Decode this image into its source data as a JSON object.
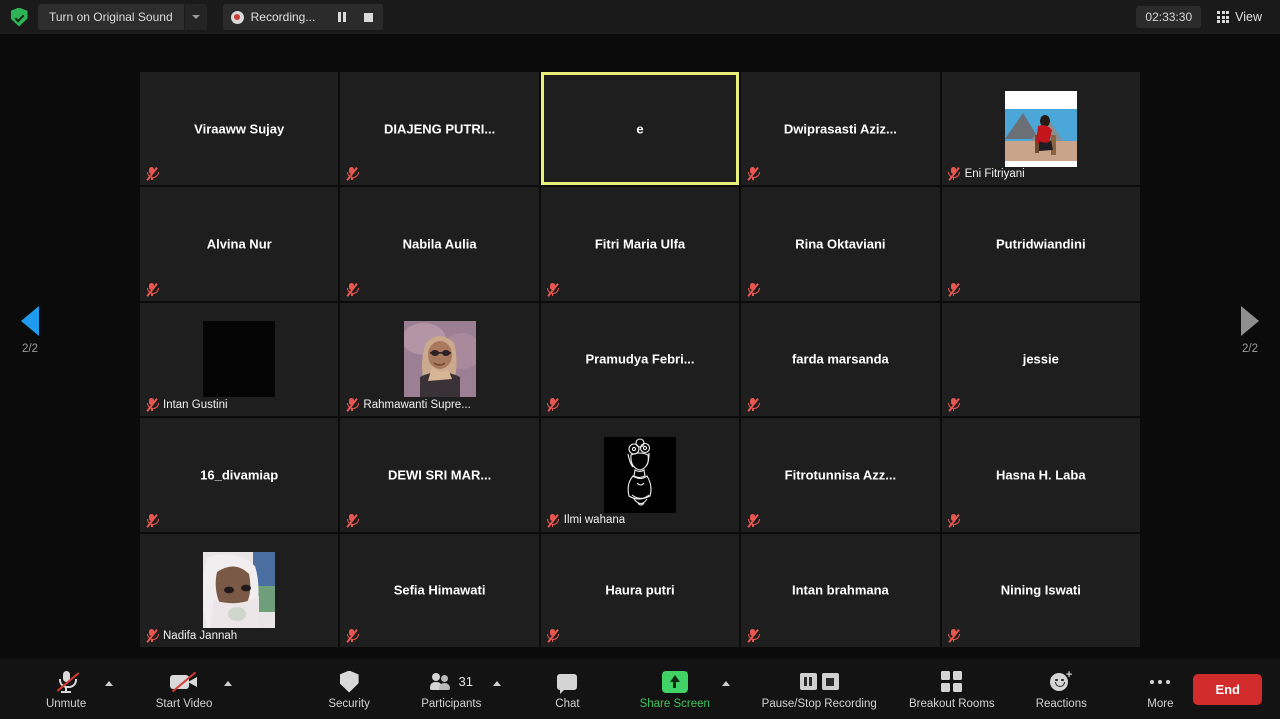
{
  "topbar": {
    "shield_icon": "shield-check-icon",
    "original_sound_label": "Turn on Original Sound",
    "recording_label": "Recording...",
    "pause_icon": "pause-icon",
    "stop_icon": "stop-icon",
    "timer": "02:33:30",
    "view_label": "View",
    "view_icon": "grid-view-icon"
  },
  "gallery": {
    "pager_left": "2/2",
    "pager_right": "2/2",
    "tiles": [
      {
        "name": "Viraaww Sujay",
        "layout": "center",
        "muted": true,
        "active": false
      },
      {
        "name": "DIAJENG PUTRI...",
        "layout": "center",
        "muted": true,
        "active": false
      },
      {
        "name": "e",
        "layout": "center",
        "muted": false,
        "active": true
      },
      {
        "name": "Dwiprasasti  Aziz...",
        "layout": "center",
        "muted": true,
        "active": false
      },
      {
        "name": "Eni Fitriyani",
        "layout": "avatar",
        "avatar": "photo-beach",
        "muted": true,
        "active": false
      },
      {
        "name": "Alvina Nur",
        "layout": "center",
        "muted": true,
        "active": false
      },
      {
        "name": "Nabila Aulia",
        "layout": "center",
        "muted": true,
        "active": false
      },
      {
        "name": "Fitri Maria Ulfa",
        "layout": "center",
        "muted": true,
        "active": false
      },
      {
        "name": "Rina Oktaviani",
        "layout": "center",
        "muted": true,
        "active": false
      },
      {
        "name": "Putridwiandini",
        "layout": "center",
        "muted": true,
        "active": false
      },
      {
        "name": "Intan Gustini",
        "layout": "avatar",
        "avatar": "photo-black",
        "muted": true,
        "active": false
      },
      {
        "name": "Rahmawanti Supre...",
        "layout": "avatar",
        "avatar": "photo-hijab",
        "muted": true,
        "active": false
      },
      {
        "name": "Pramudya  Febri...",
        "layout": "center",
        "muted": true,
        "active": false
      },
      {
        "name": "farda marsanda",
        "layout": "center",
        "muted": true,
        "active": false
      },
      {
        "name": "jessie",
        "layout": "center",
        "muted": true,
        "active": false
      },
      {
        "name": "16_divamiap",
        "layout": "center",
        "muted": true,
        "active": false
      },
      {
        "name": "DEWI SRI MAR...",
        "layout": "center",
        "muted": true,
        "active": false
      },
      {
        "name": "Ilmi wahana",
        "layout": "avatar",
        "avatar": "lineart-figure",
        "muted": true,
        "active": false
      },
      {
        "name": "Fitrotunnisa  Azz...",
        "layout": "center",
        "muted": true,
        "active": false
      },
      {
        "name": "Hasna H. Laba",
        "layout": "center",
        "muted": true,
        "active": false
      },
      {
        "name": "Nadifa Jannah",
        "layout": "avatar",
        "avatar": "photo-veil",
        "muted": true,
        "active": false
      },
      {
        "name": "Sefia Himawati",
        "layout": "center",
        "muted": true,
        "active": false
      },
      {
        "name": "Haura putri",
        "layout": "center",
        "muted": true,
        "active": false
      },
      {
        "name": "Intan brahmana",
        "layout": "center",
        "muted": true,
        "active": false
      },
      {
        "name": "Nining Iswati",
        "layout": "center",
        "muted": true,
        "active": false
      }
    ]
  },
  "toolbar": {
    "unmute_label": "Unmute",
    "start_video_label": "Start Video",
    "security_label": "Security",
    "participants_label": "Participants",
    "participants_count": "31",
    "chat_label": "Chat",
    "share_screen_label": "Share Screen",
    "recording_ctl_label": "Pause/Stop Recording",
    "breakout_label": "Breakout Rooms",
    "reactions_label": "Reactions",
    "more_label": "More",
    "end_label": "End"
  },
  "colors": {
    "accent_green": "#41d366",
    "active_speaker": "#e9f07a",
    "mute_red": "#e8564f",
    "end_red": "#d22b2b",
    "pager_active": "#1f9cf0",
    "background": "#0b0b0b",
    "tile": "#1e1e1e"
  }
}
